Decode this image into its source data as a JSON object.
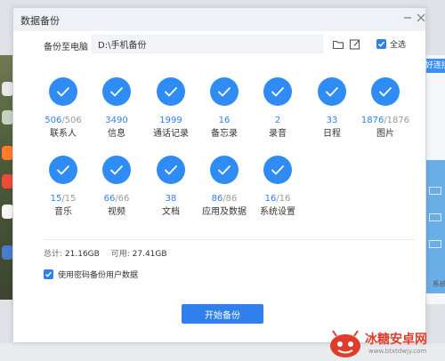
{
  "window": {
    "title": "数据备份"
  },
  "path": {
    "label": "备份至电脑",
    "value": "D:\\手机备份"
  },
  "select_all": {
    "label": "全选",
    "checked": true
  },
  "categories": [
    {
      "name": "联系人",
      "done": "506",
      "total": "/506"
    },
    {
      "name": "信息",
      "done": "3490",
      "total": ""
    },
    {
      "name": "通话记录",
      "done": "1999",
      "total": ""
    },
    {
      "name": "备忘录",
      "done": "16",
      "total": ""
    },
    {
      "name": "录音",
      "done": "2",
      "total": ""
    },
    {
      "name": "日程",
      "done": "33",
      "total": ""
    },
    {
      "name": "图片",
      "done": "1876",
      "total": "/1876"
    },
    {
      "name": "音乐",
      "done": "15",
      "total": "/15"
    },
    {
      "name": "视频",
      "done": "66",
      "total": "/66"
    },
    {
      "name": "文档",
      "done": "38",
      "total": ""
    },
    {
      "name": "应用及数据",
      "done": "86",
      "total": "/86"
    },
    {
      "name": "系统设置",
      "done": "16",
      "total": "/16"
    }
  ],
  "storage": {
    "total_label": "总计:",
    "total_value": "21.16GB",
    "free_label": "可用:",
    "free_value": "27.41GB"
  },
  "password_option": {
    "label": "使用密码备份用户数据",
    "checked": true
  },
  "start_button": {
    "label": "开始备份"
  },
  "background": {
    "right_button": "好连接",
    "right_label": "系统"
  },
  "watermark": {
    "text": "冰糖安卓网",
    "url": "www.btxtdwjy.com"
  },
  "colors": {
    "accent": "#2f80ed",
    "tile": "#2f8cf5"
  },
  "icons": {
    "folder": "folder-icon",
    "edit": "edit-icon",
    "check": "check-icon",
    "minimize": "minimize-icon",
    "close": "close-icon"
  }
}
